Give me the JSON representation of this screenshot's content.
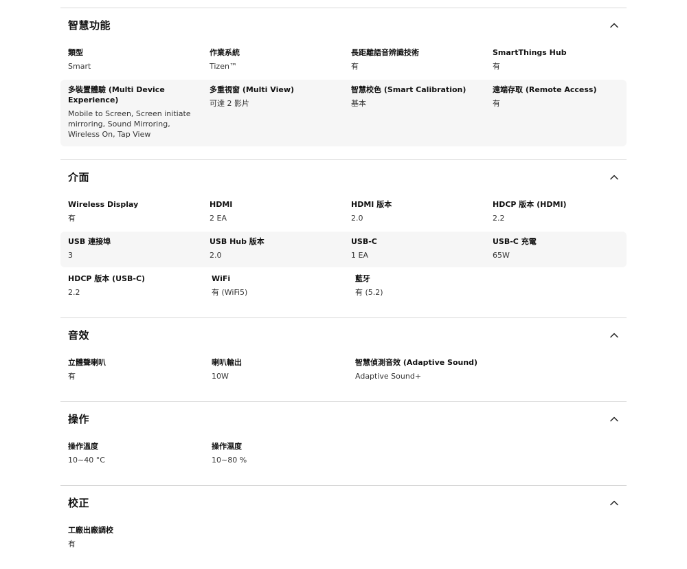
{
  "sections": [
    {
      "title": "智慧功能",
      "rows": [
        {
          "shaded": false,
          "cells": [
            {
              "label": "類型",
              "value": "Smart"
            },
            {
              "label": "作業系統",
              "value": "Tizen™"
            },
            {
              "label": "長距離語音辨識技術",
              "value": "有"
            },
            {
              "label": "SmartThings Hub",
              "value": "有"
            }
          ]
        },
        {
          "shaded": true,
          "cells": [
            {
              "label": "多裝置體驗 (Multi Device Experience)",
              "value": "Mobile to Screen, Screen initiate mirroring, Sound Mirroring, Wireless On, Tap View"
            },
            {
              "label": "多重視窗 (Multi View)",
              "value": "可達 2 影片"
            },
            {
              "label": "智慧校色 (Smart Calibration)",
              "value": "基本"
            },
            {
              "label": "遠端存取 (Remote Access)",
              "value": "有"
            }
          ]
        }
      ]
    },
    {
      "title": "介面",
      "rows": [
        {
          "shaded": false,
          "cells": [
            {
              "label": "Wireless Display",
              "value": "有"
            },
            {
              "label": "HDMI",
              "value": "2 EA"
            },
            {
              "label": "HDMI 版本",
              "value": "2.0"
            },
            {
              "label": "HDCP 版本 (HDMI)",
              "value": "2.2"
            }
          ]
        },
        {
          "shaded": true,
          "cells": [
            {
              "label": "USB 連接埠",
              "value": "3"
            },
            {
              "label": "USB Hub 版本",
              "value": "2.0"
            },
            {
              "label": "USB-C",
              "value": "1 EA"
            },
            {
              "label": "USB-C 充電",
              "value": "65W"
            }
          ]
        },
        {
          "shaded": false,
          "cells": [
            {
              "label": "HDCP 版本 (USB-C)",
              "value": "2.2"
            },
            {
              "label": "WiFi",
              "value": "有 (WiFi5)"
            },
            {
              "label": "藍牙",
              "value": "有 (5.2)"
            }
          ]
        }
      ]
    },
    {
      "title": "音效",
      "rows": [
        {
          "shaded": false,
          "cells": [
            {
              "label": "立體聲喇叭",
              "value": "有"
            },
            {
              "label": "喇叭輸出",
              "value": "10W"
            },
            {
              "label": "智慧偵測音效 (Adaptive Sound)",
              "value": "Adaptive Sound+"
            }
          ]
        }
      ]
    },
    {
      "title": "操作",
      "rows": [
        {
          "shaded": false,
          "cells": [
            {
              "label": "操作溫度",
              "value": "10~40 °C"
            },
            {
              "label": "操作濕度",
              "value": "10~80 %"
            }
          ]
        }
      ]
    },
    {
      "title": "校正",
      "rows": [
        {
          "shaded": false,
          "cells": [
            {
              "label": "工廠出廠調校",
              "value": "有"
            }
          ]
        }
      ]
    }
  ],
  "icons": {
    "toggle": "chevron-up-icon"
  }
}
